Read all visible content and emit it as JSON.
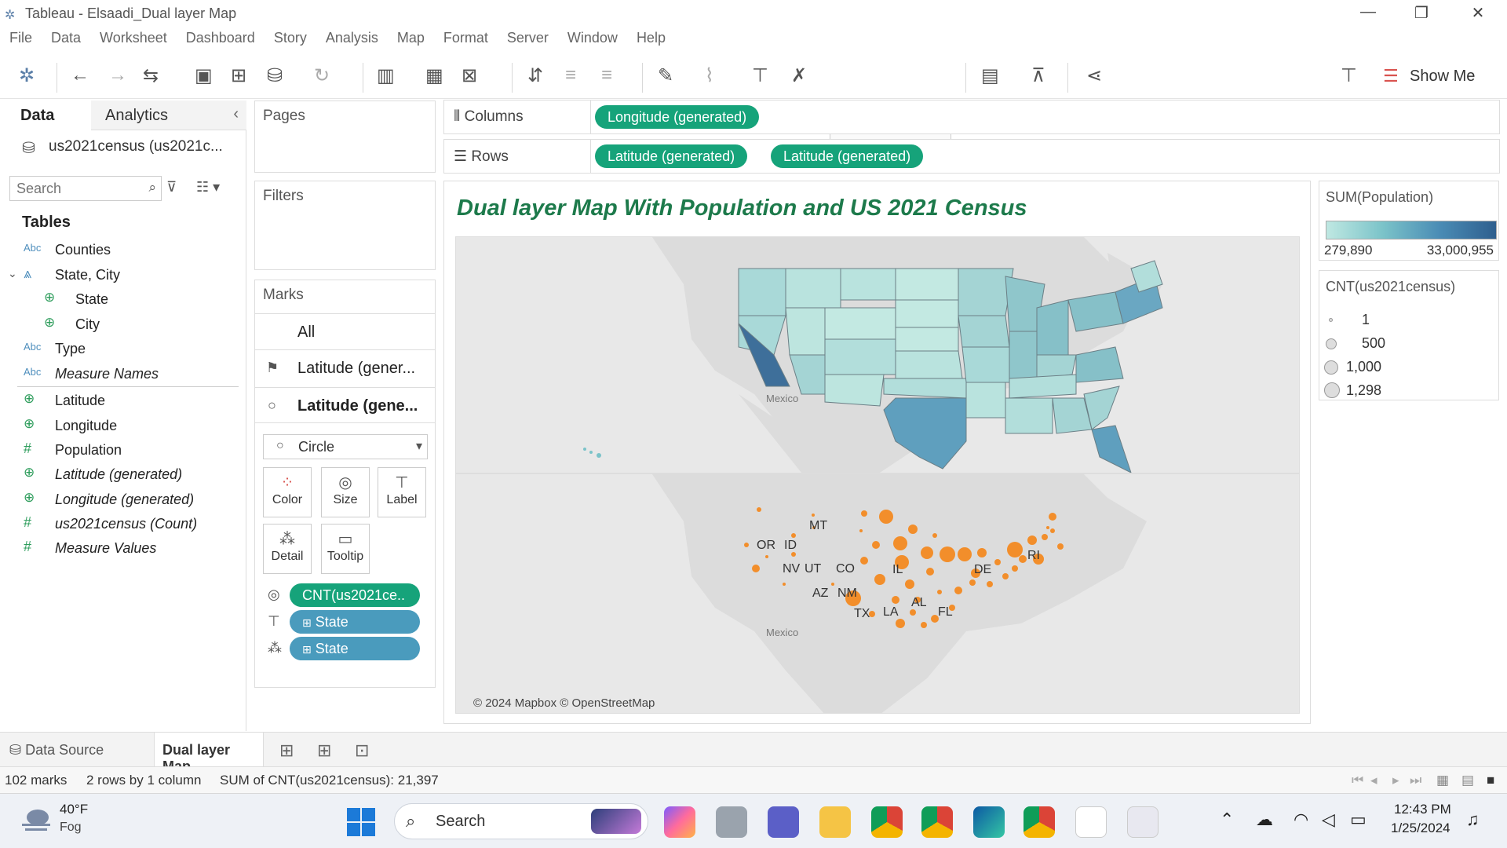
{
  "window": {
    "title": "Tableau - Elsaadi_Dual layer Map"
  },
  "menu": [
    "File",
    "Data",
    "Worksheet",
    "Dashboard",
    "Story",
    "Analysis",
    "Map",
    "Format",
    "Server",
    "Window",
    "Help"
  ],
  "toolbar": {
    "show_me_label": "Show Me"
  },
  "data_pane": {
    "tab_data": "Data",
    "tab_analytics": "Analytics",
    "datasource": "us2021census (us2021c...",
    "search_placeholder": "Search",
    "tables_heading": "Tables",
    "fields": [
      {
        "type": "Abc",
        "name": "Counties"
      },
      {
        "type": "hier",
        "name": "State, City"
      },
      {
        "type": "geo",
        "name": "State"
      },
      {
        "type": "geo",
        "name": "City"
      },
      {
        "type": "Abc",
        "name": "Type"
      },
      {
        "type": "Abc",
        "name": "Measure Names"
      },
      {
        "type": "geo",
        "name": "Latitude"
      },
      {
        "type": "geo",
        "name": "Longitude"
      },
      {
        "type": "num",
        "name": "Population"
      },
      {
        "type": "geo",
        "name": "Latitude (generated)"
      },
      {
        "type": "geo",
        "name": "Longitude (generated)"
      },
      {
        "type": "num",
        "name": "us2021census (Count)"
      },
      {
        "type": "num",
        "name": "Measure Values"
      }
    ]
  },
  "cards": {
    "pages": "Pages",
    "filters": "Filters",
    "marks": "Marks",
    "marks_all": "All",
    "marks_layer1": "Latitude (gener...",
    "marks_layer2": "Latitude (gene...",
    "mark_type": "Circle",
    "buttons": {
      "color": "Color",
      "size": "Size",
      "label": "Label",
      "detail": "Detail",
      "tooltip": "Tooltip"
    },
    "mark_pills": [
      "CNT(us2021ce..",
      "State",
      "State"
    ]
  },
  "shelves": {
    "columns_label": "Columns",
    "rows_label": "Rows",
    "columns_pills": [
      "Longitude (generated)"
    ],
    "rows_pills": [
      "Latitude (generated)",
      "Latitude (generated)"
    ]
  },
  "viz": {
    "title": "Dual layer Map With Population and US 2021 Census",
    "top_map_label": "Mexico",
    "bottom_map_label": "Mexico",
    "attribution": "© 2024 Mapbox © OpenStreetMap",
    "state_labels": [
      "MT",
      "OR",
      "ID",
      "NV",
      "UT",
      "CO",
      "AZ",
      "NM",
      "TX",
      "LA",
      "AL",
      "FL",
      "IL",
      "DE",
      "RI"
    ],
    "colors": {
      "pill_green": "#16a37a",
      "pill_blue": "#4a9bbd",
      "circle_orange": "#f28e2b",
      "title_green": "#1d7a4b"
    }
  },
  "legends": {
    "population_title": "SUM(Population)",
    "population_min": "279,890",
    "population_max": "33,000,955",
    "count_title": "CNT(us2021census)",
    "count_items": [
      "1",
      "500",
      "1,000",
      "1,298"
    ]
  },
  "tabs": {
    "data_source": "Data Source",
    "sheet": "Dual layer Map"
  },
  "status": {
    "marks": "102 marks",
    "rows": "2 rows by 1 column",
    "sum": "SUM of CNT(us2021census): 21,397"
  },
  "taskbar": {
    "temp": "40°F",
    "weather": "Fog",
    "search": "Search",
    "time": "12:43 PM",
    "date": "1/25/2024"
  }
}
